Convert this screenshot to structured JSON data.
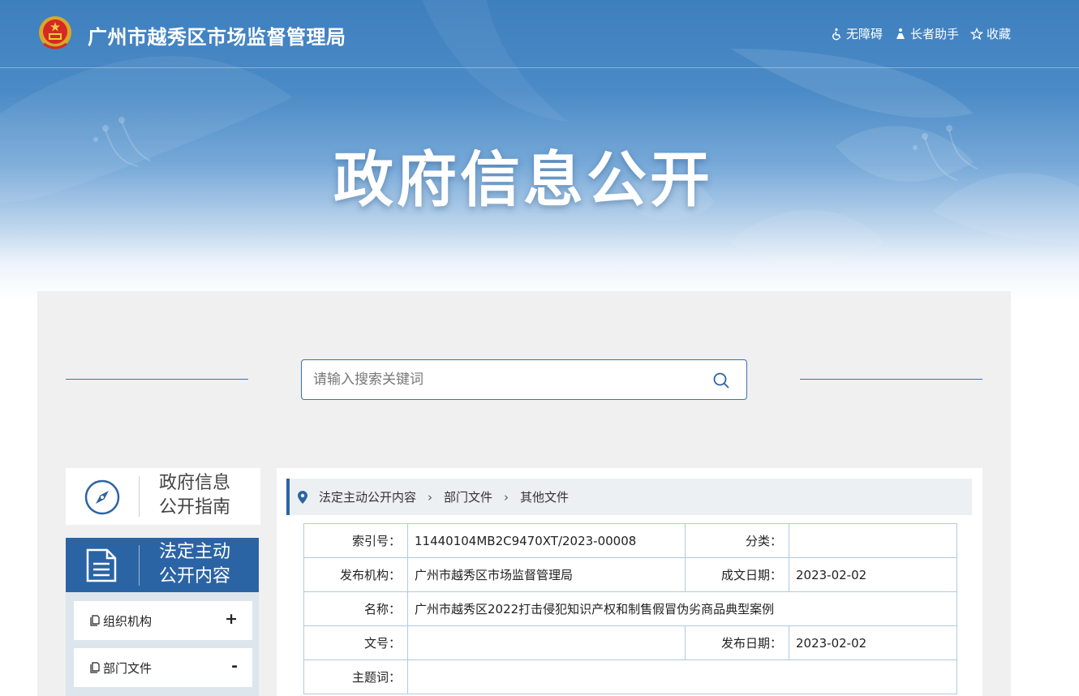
{
  "header": {
    "site_title": "广州市越秀区市场监督管理局",
    "links": [
      {
        "label": "无障碍",
        "icon": "wheelchair-icon"
      },
      {
        "label": "长者助手",
        "icon": "elder-helper-icon"
      },
      {
        "label": "收藏",
        "icon": "star-icon"
      }
    ],
    "banner_title": "政府信息公开"
  },
  "search": {
    "placeholder": "请输入搜索关键词",
    "value": ""
  },
  "sidebar": {
    "guide_card": {
      "label_line1": "政府信息",
      "label_line2": "公开指南",
      "icon": "compass-icon"
    },
    "active_card": {
      "label_line1": "法定主动",
      "label_line2": "公开内容",
      "icon": "document-icon"
    },
    "items": [
      {
        "label": "组织机构",
        "toggle": "+"
      },
      {
        "label": "部门文件",
        "toggle": "-"
      }
    ]
  },
  "breadcrumb": [
    "法定主动公开内容",
    "部门文件",
    "其他文件"
  ],
  "meta": {
    "index_label": "索引号：",
    "index_value": "11440104MB2C9470XT/2023-00008",
    "category_label": "分类：",
    "category_value": "",
    "publisher_label": "发布机构：",
    "publisher_value": "广州市越秀区市场监督管理局",
    "written_label": "成文日期：",
    "written_value": "2023-02-02",
    "name_label": "名称：",
    "name_value": "广州市越秀区2022打击侵犯知识产权和制售假冒伪劣商品典型案例",
    "docno_label": "文号：",
    "docno_value": "",
    "pubdate_label": "发布日期：",
    "pubdate_value": "2023-02-02",
    "subject_label": "主题词：",
    "subject_value": ""
  },
  "colors": {
    "primary": "#2b64a4",
    "banner_blue": "#3e7fbe",
    "table_border": "#b0c9e3"
  }
}
